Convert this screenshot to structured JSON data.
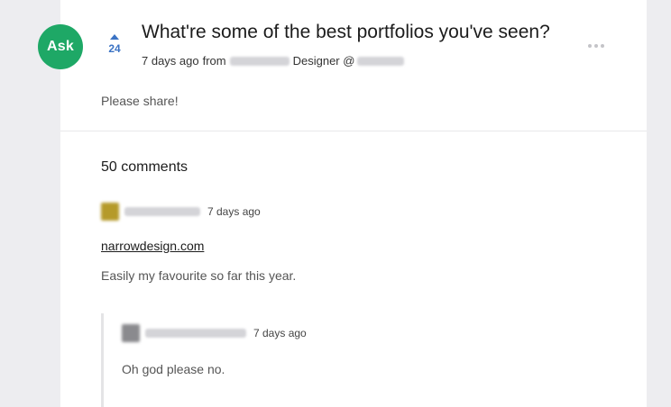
{
  "post": {
    "badge_label": "Ask",
    "upvotes": "24",
    "title": "What're some of the best portfolios you've seen?",
    "time_ago": "7 days ago",
    "from_label": "from",
    "role": "Designer @",
    "body": "Please share!"
  },
  "comments": {
    "heading": "50 comments",
    "items": [
      {
        "time_ago": "7 days ago",
        "link_text": "narrowdesign.com",
        "text": "Easily my favourite so far this year.",
        "avatar_color": "#b59a2a"
      },
      {
        "time_ago": "7 days ago",
        "text": "Oh god please no.",
        "avatar_color": "#8a8a8e"
      }
    ]
  },
  "colors": {
    "ask_green": "#1ea866",
    "vote_blue": "#3b73c4",
    "background": "#ededf0"
  },
  "icons": [
    "upvote-arrow-icon",
    "more-options-icon"
  ]
}
